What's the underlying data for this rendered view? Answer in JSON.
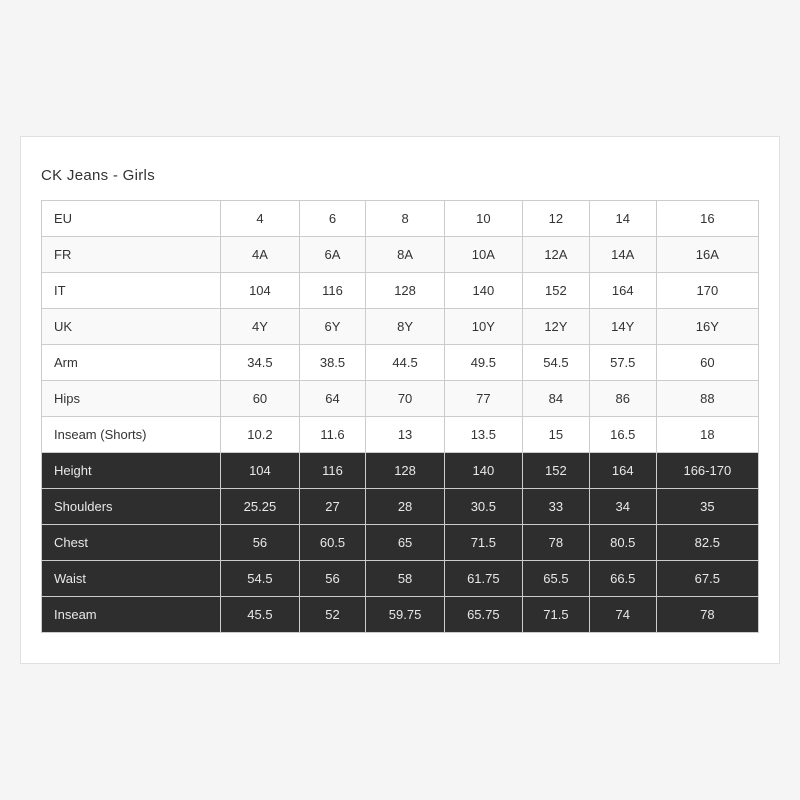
{
  "title": "CK Jeans - Girls",
  "columns": [
    "EU",
    "4",
    "6",
    "8",
    "10",
    "12",
    "14",
    "16"
  ],
  "rows": [
    {
      "label": "FR",
      "values": [
        "4A",
        "6A",
        "8A",
        "10A",
        "12A",
        "14A",
        "16A"
      ],
      "dark": false
    },
    {
      "label": "IT",
      "values": [
        "104",
        "116",
        "128",
        "140",
        "152",
        "164",
        "170"
      ],
      "dark": false
    },
    {
      "label": "UK",
      "values": [
        "4Y",
        "6Y",
        "8Y",
        "10Y",
        "12Y",
        "14Y",
        "16Y"
      ],
      "dark": false
    },
    {
      "label": "Arm",
      "values": [
        "34.5",
        "38.5",
        "44.5",
        "49.5",
        "54.5",
        "57.5",
        "60"
      ],
      "dark": false
    },
    {
      "label": "Hips",
      "values": [
        "60",
        "64",
        "70",
        "77",
        "84",
        "86",
        "88"
      ],
      "dark": false
    },
    {
      "label": "Inseam (Shorts)",
      "values": [
        "10.2",
        "11.6",
        "13",
        "13.5",
        "15",
        "16.5",
        "18"
      ],
      "dark": false
    },
    {
      "label": "Height",
      "values": [
        "104",
        "116",
        "128",
        "140",
        "152",
        "164",
        "166-170"
      ],
      "dark": true
    },
    {
      "label": "Shoulders",
      "values": [
        "25.25",
        "27",
        "28",
        "30.5",
        "33",
        "34",
        "35"
      ],
      "dark": true
    },
    {
      "label": "Chest",
      "values": [
        "56",
        "60.5",
        "65",
        "71.5",
        "78",
        "80.5",
        "82.5"
      ],
      "dark": true
    },
    {
      "label": "Waist",
      "values": [
        "54.5",
        "56",
        "58",
        "61.75",
        "65.5",
        "66.5",
        "67.5"
      ],
      "dark": true
    },
    {
      "label": "Inseam",
      "values": [
        "45.5",
        "52",
        "59.75",
        "65.75",
        "71.5",
        "74",
        "78"
      ],
      "dark": true
    }
  ]
}
